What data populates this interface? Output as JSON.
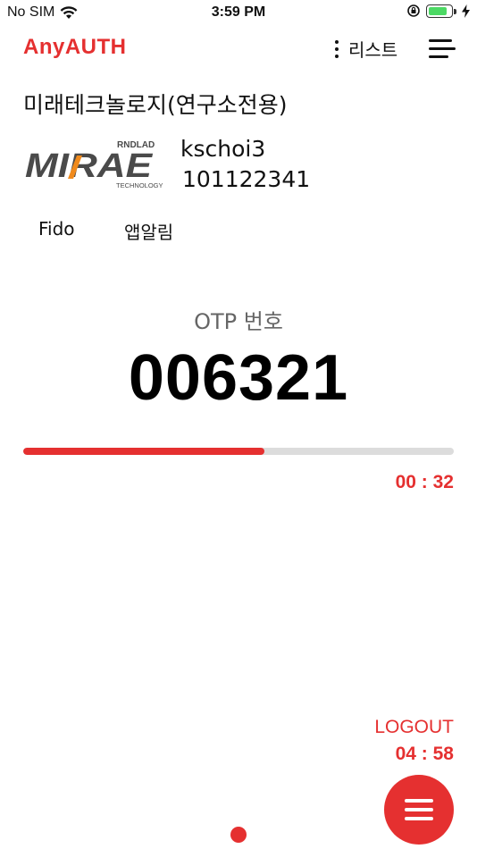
{
  "status_bar": {
    "carrier": "No SIM",
    "time": "3:59 PM"
  },
  "header": {
    "brand": "AnyAUTH",
    "list_label": "리스트"
  },
  "org": {
    "title": "미래테크놀로지(연구소전용)"
  },
  "logo": {
    "top_text": "RNDLAD",
    "main_text": "MIRAE",
    "sub_text": "TECHNOLOGY"
  },
  "user": {
    "id": "kschoi3",
    "number": "101122341"
  },
  "tabs": [
    {
      "label": "Fido"
    },
    {
      "label": "앱알림"
    }
  ],
  "otp": {
    "label": "OTP 번호",
    "code": "006321",
    "progress": 0.56,
    "timer": "00 : 32"
  },
  "session": {
    "logout_label": "LOGOUT",
    "remaining": "04 : 58"
  },
  "colors": {
    "accent": "#e53030",
    "track": "#dcdcdc",
    "logo_gray": "#4a4a4a",
    "logo_orange": "#f08a1c"
  },
  "icons": {
    "wifi": "wifi-icon",
    "rotation_lock": "rotation-lock-icon",
    "battery": "battery-icon",
    "charging": "bolt-icon",
    "kebab": "kebab-icon",
    "menu": "hamburger-icon",
    "fab": "menu-fab-icon"
  }
}
